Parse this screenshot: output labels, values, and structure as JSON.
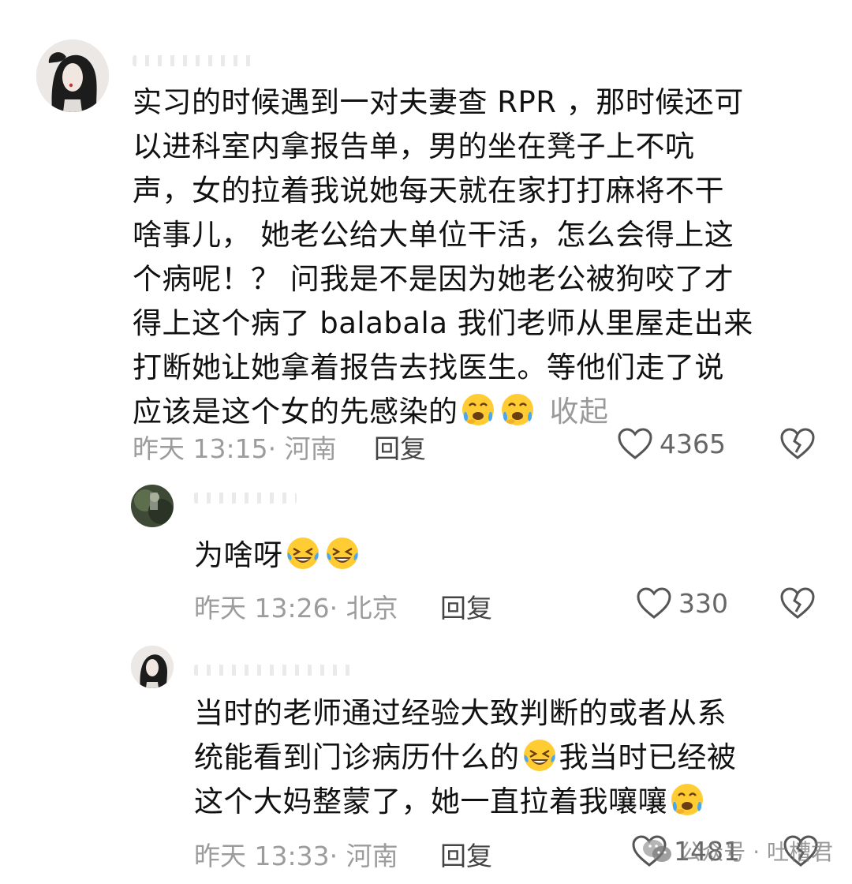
{
  "comments": [
    {
      "text": "实习的时候遇到一对夫妻查RPR，那时候还可以进科室内拿报告单，男的坐在凳子上不吭声，女的拉着我说她每天就在家打打麻将不干啥事儿，她老公给大单位干活，怎么会得上这个病呢！？问我是不是因为她老公被狗咬了才得上这个病了balabala我们老师从里屋走出来打断她让她拿着报告去找医生。等他们走了说应该是这个女的先感染的",
      "lines": [
        "实习的时候遇到一对夫妻查 RPR ，那时候还可",
        "以进科室内拿报告单，男的坐在凳子上不吭",
        "声，女的拉着我说她每天就在家打打麻将不干",
        "啥事儿， 她老公给大单位干活，怎么会得上这",
        "个病呢！？ 问我是不是因为她老公被狗咬了才",
        "得上这个病了 balabala 我们老师从里屋走出来",
        "打断她让她拿着报告去找医生。等他们走了说",
        "应该是这个女的先感染的"
      ],
      "emojis": [
        "praying-tears-emoji",
        "praying-tears-emoji"
      ],
      "collapse_label": "收起",
      "time": "昨天 13:15",
      "location": "· 河南",
      "reply_label": "回复",
      "likes": "4365"
    },
    {
      "text": "为啥呀",
      "emojis": [
        "laughing-tears-emoji",
        "laughing-tears-emoji"
      ],
      "time": "昨天 13:26",
      "location": "· 北京",
      "reply_label": "回复",
      "likes": "330"
    },
    {
      "lines": [
        "当时的老师通过经验大致判断的或者从系",
        "统能看到门诊病历什么的",
        "我当时已经被",
        "这个大妈整蒙了，她一直拉着我嚷嚷"
      ],
      "emojis": [
        "laughing-tears-emoji",
        "praying-tears-emoji"
      ],
      "time": "昨天 13:33",
      "location": "· 河南",
      "reply_label": "回复",
      "likes": "1481"
    }
  ],
  "watermark": {
    "label": "公众号 · 吐槽君"
  },
  "colors": {
    "meta": "#9c9c9c",
    "text": "#111111",
    "emoji_face": "#ffcc33",
    "tear": "#4aa8f0"
  }
}
